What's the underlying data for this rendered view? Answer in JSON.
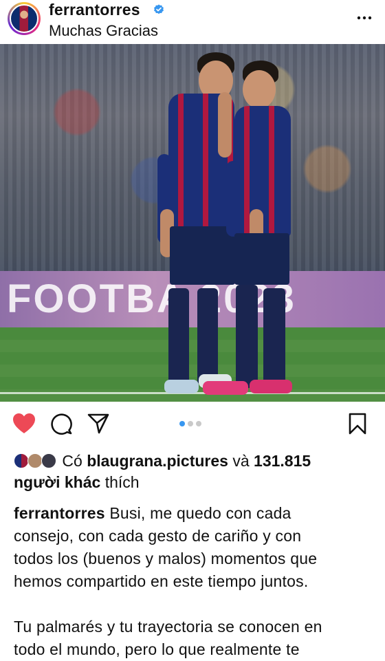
{
  "post": {
    "username": "ferrantorres",
    "location": "Muchas Gracias",
    "carousel_index": 1,
    "carousel_total": 3
  },
  "photo": {
    "board_text": "FOOTBA   2023"
  },
  "likes": {
    "prefix": "Có",
    "liked_by": "blaugrana.pictures",
    "and": "và",
    "count": "131.815",
    "others": "người khác",
    "suffix": "thích"
  },
  "caption": {
    "username": "ferrantorres",
    "lines1": [
      "Busi, me quedo con cada",
      "consejo, con cada gesto de cariño y con",
      "todos los (buenos y malos) momentos que",
      "hemos compartido en este tiempo juntos."
    ],
    "lines2": [
      "Tu palmarés y tu trayectoria se conocen en",
      "todo el mundo, pero lo que realmente te"
    ]
  },
  "icons": {
    "like": "heart-icon",
    "comment": "comment-icon",
    "share": "send-icon",
    "save": "bookmark-icon",
    "more": "more-options-icon",
    "verified": "verified-badge-icon"
  },
  "colors": {
    "like_red": "#ed4956",
    "verified_blue": "#3897f0",
    "dot_active": "#3897f0"
  }
}
